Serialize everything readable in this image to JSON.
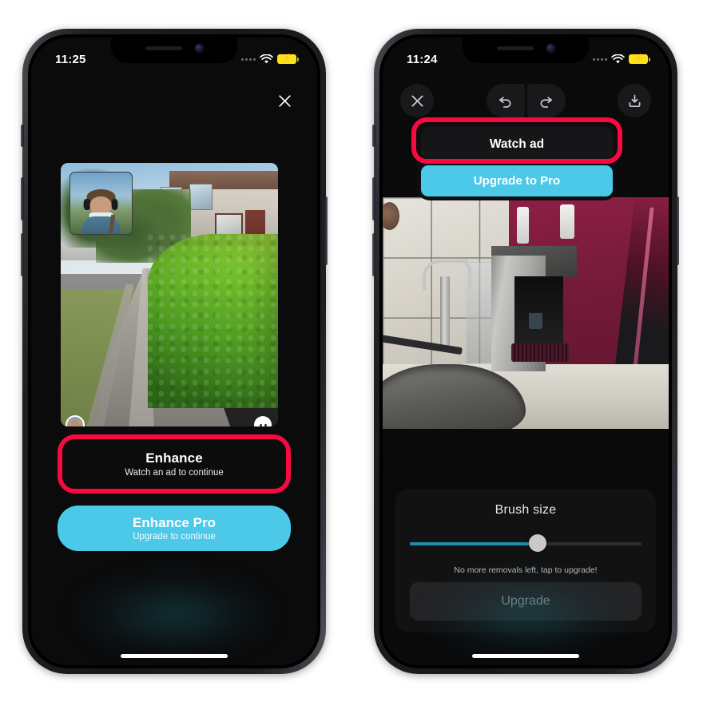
{
  "theme": {
    "highlight_color": "#f80a40",
    "accent_cyan": "#4cc9e8",
    "screen_bg": "#0a0a0b"
  },
  "left_phone": {
    "status_bar": {
      "clock": "11:25",
      "signal_icon": "signal-dots-icon",
      "wifi_icon": "wifi-icon",
      "battery_icon": "battery-charging-icon"
    },
    "close_icon": "close-icon",
    "photo": {
      "name": "enhance-preview-photo",
      "description": "Street pavement with hedge and houses",
      "pip_label": "selfie-pip",
      "avatar_icon": "avatar-icon",
      "emoji_icon": "emoji-face-icon"
    },
    "primary_button": {
      "title": "Enhance",
      "subtitle": "Watch an ad to continue",
      "highlighted": "true"
    },
    "secondary_button": {
      "title": "Enhance Pro",
      "subtitle": "Upgrade to continue"
    },
    "home_indicator": "home-indicator"
  },
  "right_phone": {
    "status_bar": {
      "clock": "11:24",
      "signal_icon": "signal-dots-icon",
      "wifi_icon": "wifi-icon",
      "battery_icon": "battery-charging-icon"
    },
    "toolbar": {
      "close_icon": "close-icon",
      "undo_icon": "undo-icon",
      "redo_icon": "redo-icon",
      "save_icon": "download-save-icon"
    },
    "popover": {
      "watch_ad_label": "Watch ad",
      "upgrade_label": "Upgrade to Pro",
      "highlighted": "true"
    },
    "photo": {
      "name": "object-removal-photo",
      "description": "Kitchen sink with tap and water dispenser"
    },
    "brush_panel": {
      "title": "Brush size",
      "slider_value": 55,
      "slider_min": 0,
      "slider_max": 100,
      "note": "No more removals left, tap to upgrade!",
      "upgrade_button": "Upgrade"
    },
    "home_indicator": "home-indicator"
  }
}
